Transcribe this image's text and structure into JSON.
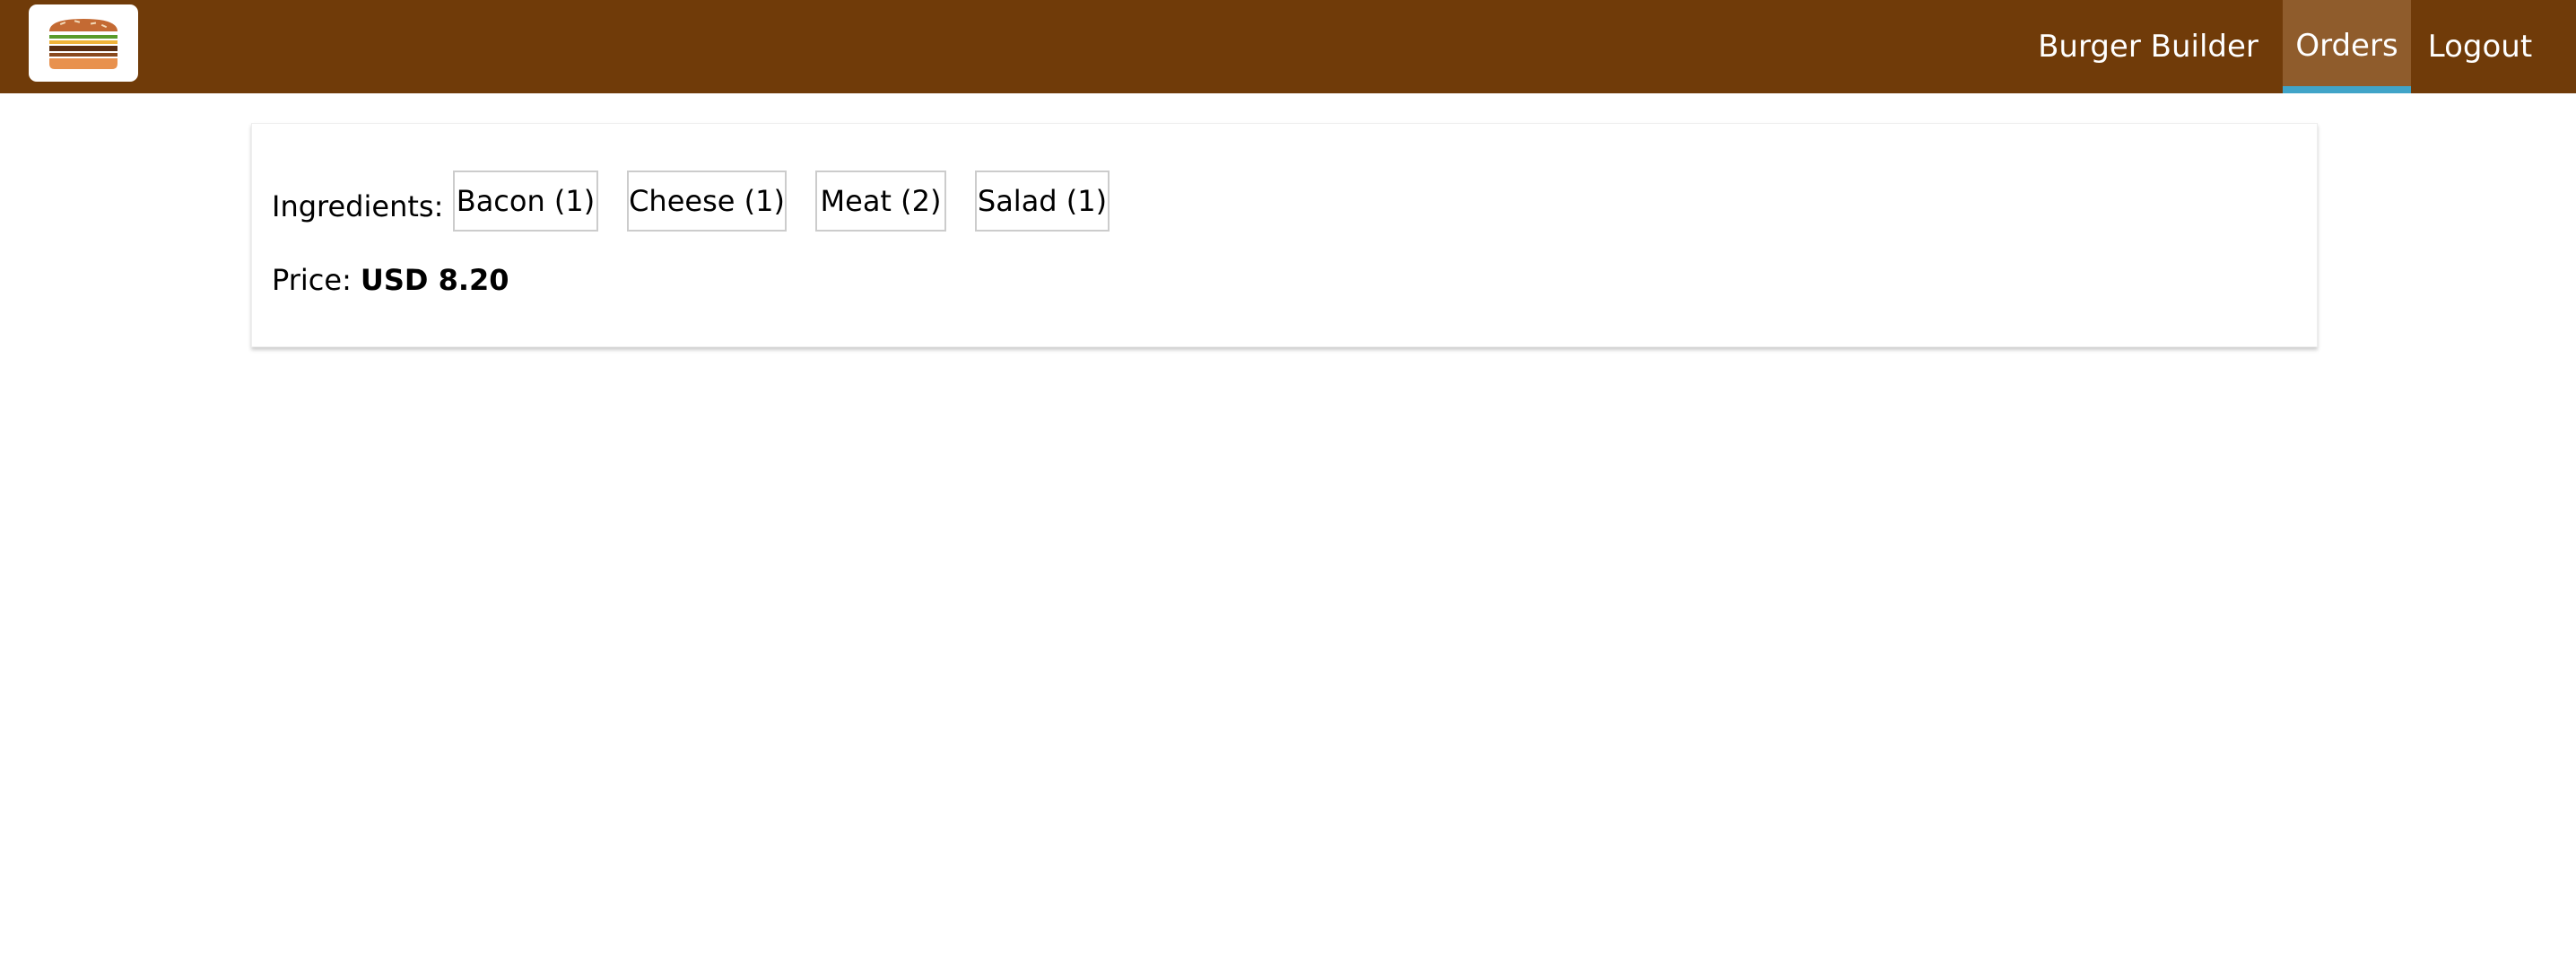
{
  "app": {
    "logo_icon": "burger-logo-icon",
    "colors": {
      "toolbar": "#703b09",
      "active_tab": "#8f5c2c",
      "active_underline": "#40a4c8"
    }
  },
  "nav": {
    "items": [
      {
        "label": "Burger Builder",
        "active": false
      },
      {
        "label": "Orders",
        "active": true
      },
      {
        "label": "Logout",
        "active": false
      }
    ]
  },
  "order": {
    "ingredients_label": "Ingredients:",
    "ingredients": [
      {
        "text": "Bacon (1)"
      },
      {
        "text": "Cheese (1)"
      },
      {
        "text": "Meat (2)"
      },
      {
        "text": "Salad (1)"
      }
    ],
    "price_label": "Price:",
    "price_value": "USD 8.20"
  }
}
